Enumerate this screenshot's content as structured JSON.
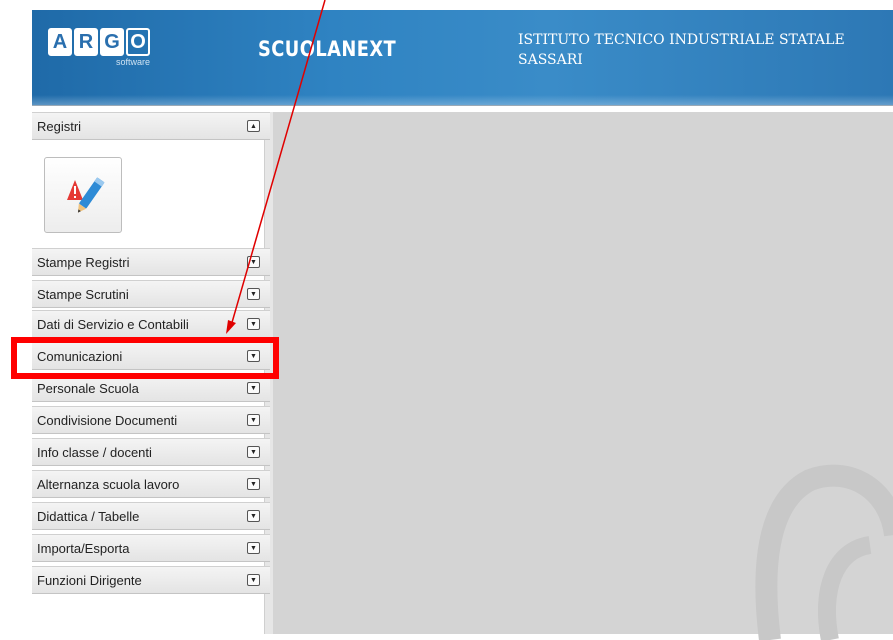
{
  "header": {
    "logo_letters": [
      "A",
      "R",
      "G",
      "O"
    ],
    "logo_sub": "software",
    "product": "SCUOLANEXT",
    "school_line1": "ISTITUTO TECNICO INDUSTRIALE STATALE",
    "school_line2": "SASSARI"
  },
  "sidebar": {
    "sections": [
      {
        "label": "Registri",
        "state": "expanded"
      },
      {
        "label": "Stampe Registri",
        "state": "collapsed"
      },
      {
        "label": "Stampe Scrutini",
        "state": "collapsed"
      },
      {
        "label": "Dati di Servizio e Contabili",
        "state": "collapsed"
      },
      {
        "label": "Comunicazioni",
        "state": "collapsed"
      },
      {
        "label": "Personale Scuola",
        "state": "collapsed"
      },
      {
        "label": "Condivisione Documenti",
        "state": "collapsed"
      },
      {
        "label": "Info classe / docenti",
        "state": "collapsed"
      },
      {
        "label": "Alternanza scuola lavoro",
        "state": "collapsed"
      },
      {
        "label": "Didattica / Tabelle",
        "state": "collapsed"
      },
      {
        "label": "Importa/Esporta",
        "state": "collapsed"
      },
      {
        "label": "Funzioni Dirigente",
        "state": "collapsed"
      }
    ],
    "registri_button_icon": "registro-edit-icon",
    "toggle_expanded_icon": "collapse-up-icon",
    "toggle_collapsed_icon": "expand-down-icon"
  },
  "annotation": {
    "arrow_color": "#e00000",
    "highlight_color": "#ff0000",
    "highlighted_item": "Comunicazioni"
  },
  "colors": {
    "header_blue": "#2f83c2",
    "content_gray": "#d4d4d4"
  }
}
